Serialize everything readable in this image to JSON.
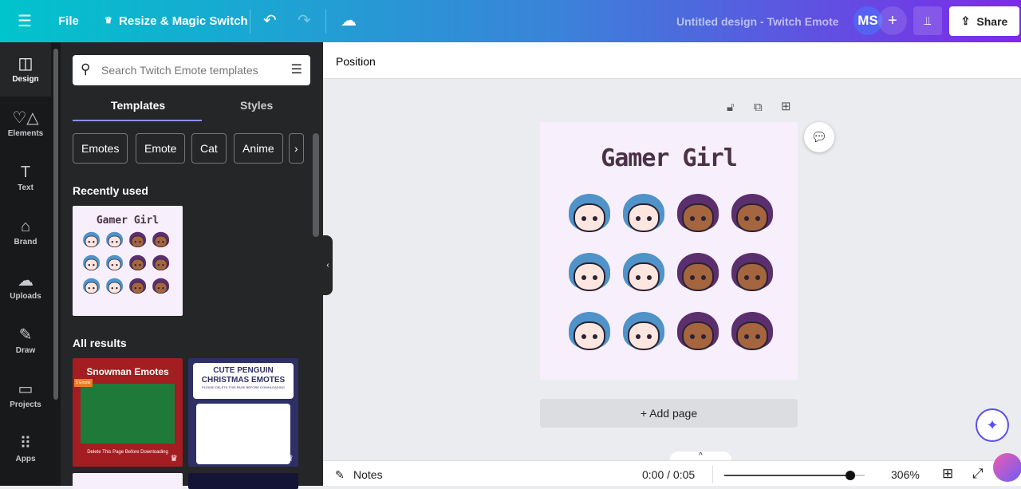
{
  "topbar": {
    "file": "File",
    "resize": "Resize & Magic Switch",
    "doc_title": "Untitled design - Twitch Emote",
    "avatar": "MS",
    "share": "Share"
  },
  "rail": [
    {
      "label": "Design",
      "icon": "layout-icon",
      "glyph": "◫"
    },
    {
      "label": "Elements",
      "icon": "shapes-icon",
      "glyph": "♡△"
    },
    {
      "label": "Text",
      "icon": "text-icon",
      "glyph": "T"
    },
    {
      "label": "Brand",
      "icon": "brand-icon",
      "glyph": "⌂"
    },
    {
      "label": "Uploads",
      "icon": "cloud-upload-icon",
      "glyph": "☁"
    },
    {
      "label": "Draw",
      "icon": "pen-icon",
      "glyph": "✎"
    },
    {
      "label": "Projects",
      "icon": "folder-icon",
      "glyph": "▭"
    },
    {
      "label": "Apps",
      "icon": "apps-icon",
      "glyph": "⠿"
    }
  ],
  "panel": {
    "search_placeholder": "Search Twitch Emote templates",
    "tabs": [
      "Templates",
      "Styles"
    ],
    "chips": [
      "Emotes",
      "Emote",
      "Cat",
      "Anime"
    ],
    "recent": "Recently used",
    "all": "All results",
    "results": [
      {
        "title": "Snowman Emotes",
        "sub": "Delete This Page Before Downloading",
        "badge": "5 Emote",
        "bg": "#a31d21"
      },
      {
        "title": "CUTE PENGUIN CHRISTMAS EMOTES",
        "sub": "PLEASE DELETE THIS PAGE BEFORE DOWNLOADING",
        "bg": "#2e2f66"
      }
    ]
  },
  "canvas": {
    "position": "Position",
    "title": "Gamer Girl",
    "add_page": "+ Add page",
    "colors": {
      "blue_hair": "#4f93c9",
      "purple_hair": "#5b2f6e",
      "light_skin": "#fde6df",
      "dark_skin": "#a4653f",
      "bg": "#f7effb"
    }
  },
  "bottom": {
    "notes": "Notes",
    "time": "0:00 / 0:05",
    "zoom": "306%",
    "zoom_fraction": 0.9
  }
}
